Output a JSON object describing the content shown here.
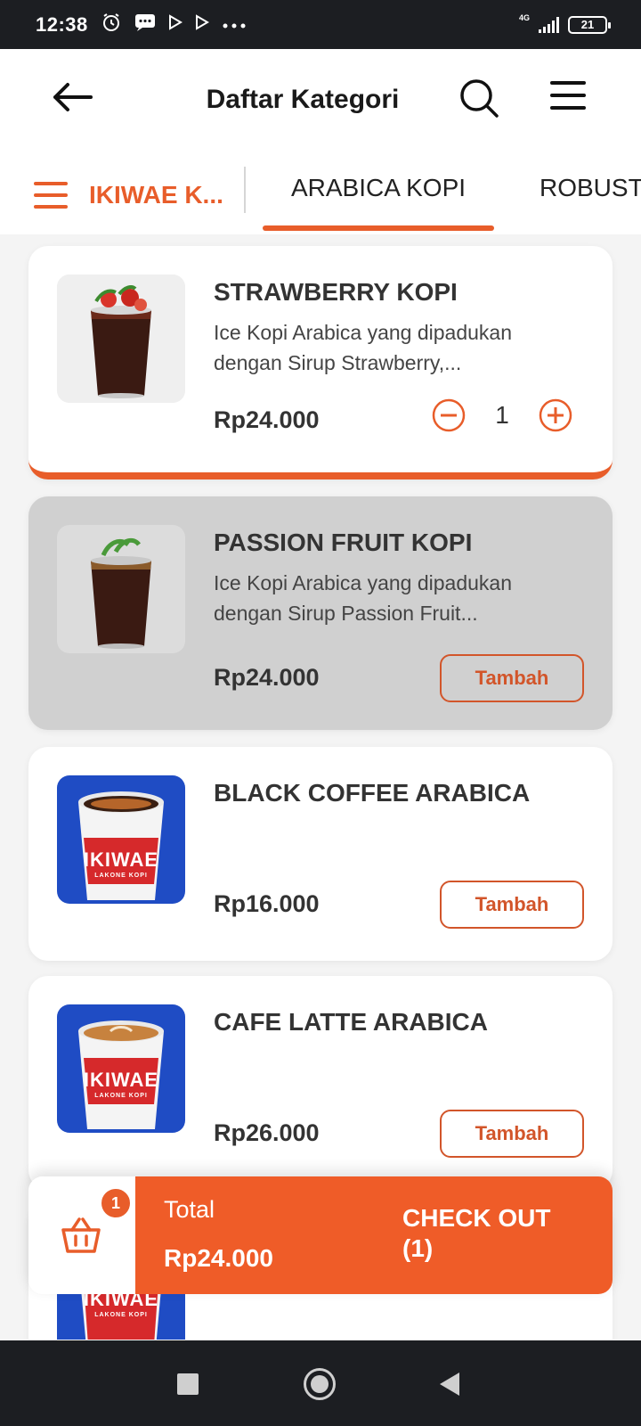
{
  "status_bar": {
    "time": "12:38",
    "network": "4G",
    "battery": "21"
  },
  "header": {
    "title": "Daftar Kategori"
  },
  "categories": {
    "menu_label": "IKIWAE K...",
    "tabs": [
      {
        "label": "ARABICA KOPI",
        "active": true
      },
      {
        "label": "ROBUSTA"
      }
    ]
  },
  "products": [
    {
      "name": "STRAWBERRY KOPI",
      "description": "Ice Kopi Arabica yang dipadukan dengan Sirup Strawberry,...",
      "price": "Rp24.000",
      "quantity": "1"
    },
    {
      "name": "PASSION FRUIT KOPI",
      "description": "Ice Kopi Arabica yang dipadukan dengan Sirup Passion Fruit...",
      "price": "Rp24.000",
      "action": "Tambah"
    },
    {
      "name": "BLACK COFFEE ARABICA",
      "price": "Rp16.000",
      "action": "Tambah",
      "cup_brand": "IKIWAE",
      "cup_sub": "LAKONE KOPI"
    },
    {
      "name": "CAFE LATTE ARABICA",
      "price": "Rp26.000",
      "action": "Tambah",
      "cup_brand": "IKIWAE",
      "cup_sub": "LAKONE KOPI"
    },
    {
      "cup_brand": "IKIWAE",
      "cup_sub": "LAKONE KOPI"
    }
  ],
  "checkout": {
    "cart_count": "1",
    "total_label": "Total",
    "total_value": "Rp24.000",
    "button_line1": "CHECK OUT",
    "button_line2": "(1)"
  },
  "colors": {
    "accent": "#e85d2a",
    "checkout_bg": "#ef5c28",
    "muted_card": "#d0d0d0"
  }
}
